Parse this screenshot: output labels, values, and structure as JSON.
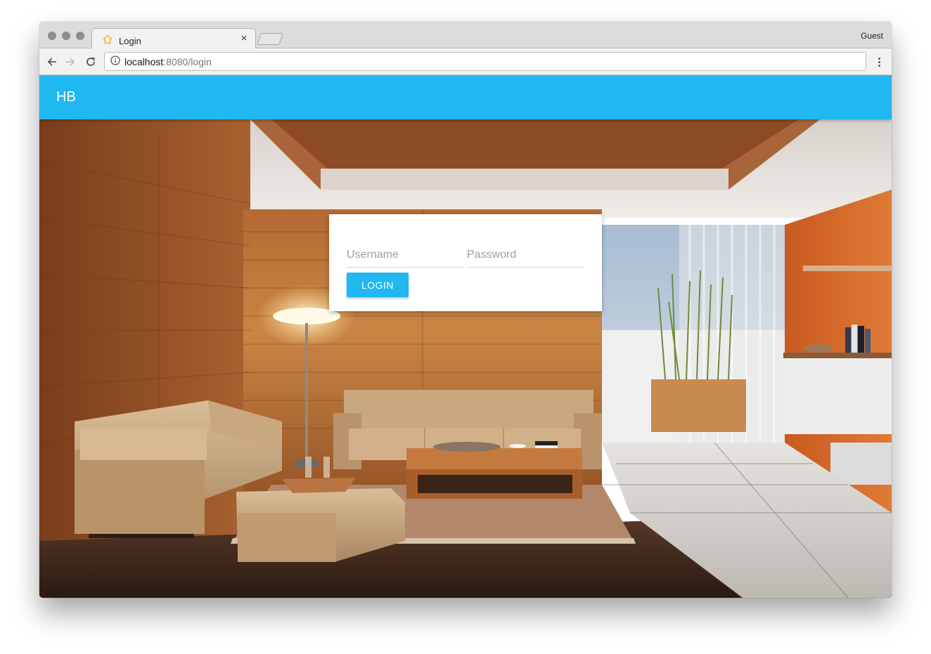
{
  "browser": {
    "tab_title": "Login",
    "profile_label": "Guest",
    "url_host": "localhost",
    "url_path": ":8080/login"
  },
  "app": {
    "brand": "HB"
  },
  "login": {
    "username_placeholder": "Username",
    "password_placeholder": "Password",
    "button_label": "LOGIN"
  },
  "colors": {
    "accent": "#1fb8f0"
  }
}
